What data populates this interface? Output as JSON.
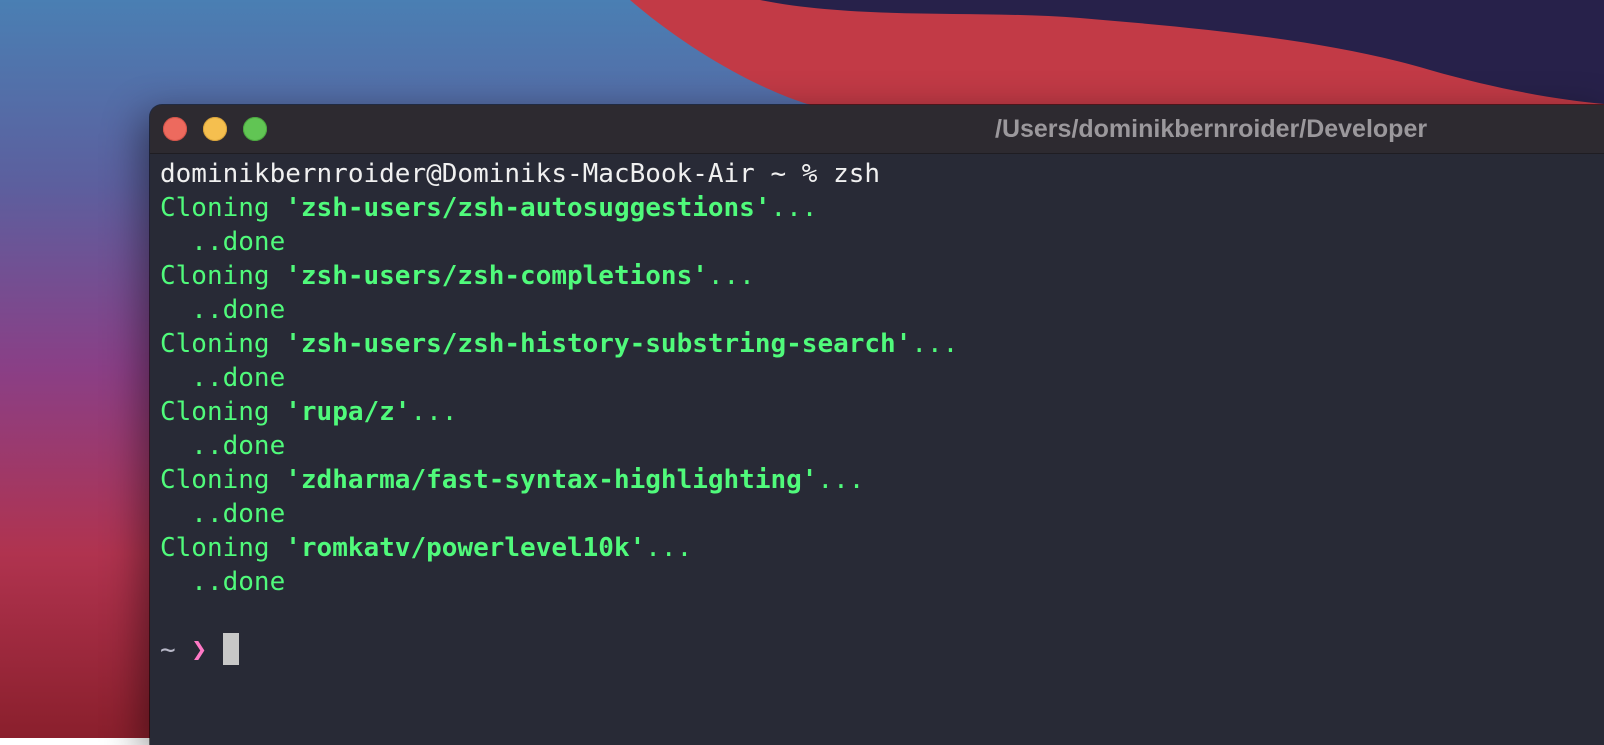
{
  "window": {
    "title": "/Users/dominikbernroider/Developer"
  },
  "terminal": {
    "command_line": "dominikbernroider@Dominiks-MacBook-Air ~ % zsh",
    "clones": [
      {
        "prefix": "Cloning ",
        "repo": "'zsh-users/zsh-autosuggestions'",
        "suffix": "...",
        "done": "  ..done"
      },
      {
        "prefix": "Cloning ",
        "repo": "'zsh-users/zsh-completions'",
        "suffix": "...",
        "done": "  ..done"
      },
      {
        "prefix": "Cloning ",
        "repo": "'zsh-users/zsh-history-substring-search'",
        "suffix": "...",
        "done": "  ..done"
      },
      {
        "prefix": "Cloning ",
        "repo": "'rupa/z'",
        "suffix": "...",
        "done": "  ..done"
      },
      {
        "prefix": "Cloning ",
        "repo": "'zdharma/fast-syntax-highlighting'",
        "suffix": "...",
        "done": "  ..done"
      },
      {
        "prefix": "Cloning ",
        "repo": "'romkatv/powerlevel10k'",
        "suffix": "...",
        "done": "  ..done"
      }
    ],
    "prompt": {
      "dir": "~",
      "symbol": "❯"
    }
  },
  "colors": {
    "terminal_bg": "#282a36",
    "clone_text": "#50fa7b",
    "prompt_symbol": "#ff79c6",
    "traffic_close": "#ed6a5e",
    "traffic_minimize": "#f5bf4f",
    "traffic_maximize": "#61c554"
  },
  "icons": {
    "close": "close-traffic-light-icon",
    "minimize": "minimize-traffic-light-icon",
    "maximize": "maximize-traffic-light-icon"
  }
}
